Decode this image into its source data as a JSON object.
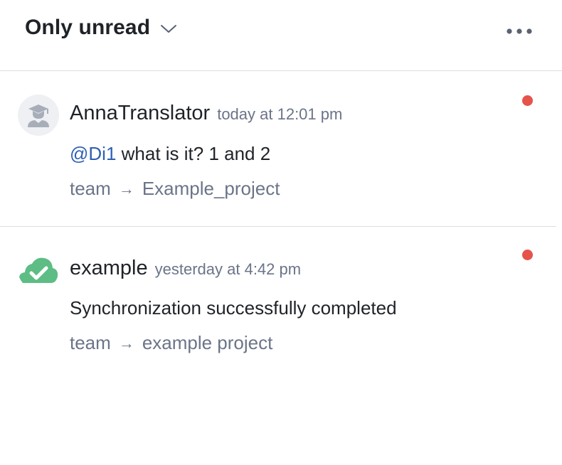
{
  "header": {
    "filter_label": "Only unread",
    "chevron_icon": "chevron-down-icon",
    "more_icon": "more-horizontal-icon"
  },
  "notifications": [
    {
      "author": "AnnaTranslator",
      "time": "today at 12:01 pm",
      "mention": "@Di1",
      "message": " what is it? 1 and 2",
      "path_from": "team",
      "path_to": "Example_project",
      "avatar_icon": "graduate-user-icon",
      "unread": true
    },
    {
      "author": "example",
      "time": "yesterday at 4:42 pm",
      "message": "Synchronization successfully completed",
      "path_from": "team",
      "path_to": "example project",
      "avatar_icon": "cloud-check-icon",
      "unread": true
    }
  ],
  "colors": {
    "mention": "#2f5fb3",
    "muted": "#6b7488",
    "unread_dot": "#e5534b",
    "cloud_green": "#5dbd84",
    "divider": "#dcdfe4"
  }
}
